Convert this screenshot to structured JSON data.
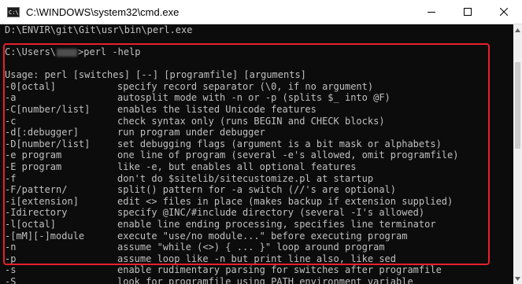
{
  "window": {
    "title": "C:\\WINDOWS\\system32\\cmd.exe",
    "icon_text": "C:\\"
  },
  "console": {
    "previous_line": "D:\\ENVIR\\git\\Git\\usr\\bin\\perl.exe",
    "prompt_prefix": "C:\\Users\\",
    "prompt_suffix": ">perl -help",
    "usage_line": "Usage: perl [switches] [--] [programfile] [arguments]",
    "options": [
      {
        "flag": "-0[octal]",
        "desc": "specify record separator (\\0, if no argument)"
      },
      {
        "flag": "-a",
        "desc": "autosplit mode with -n or -p (splits $_ into @F)"
      },
      {
        "flag": "-C[number/list]",
        "desc": "enables the listed Unicode features"
      },
      {
        "flag": "-c",
        "desc": "check syntax only (runs BEGIN and CHECK blocks)"
      },
      {
        "flag": "-d[:debugger]",
        "desc": "run program under debugger"
      },
      {
        "flag": "-D[number/list]",
        "desc": "set debugging flags (argument is a bit mask or alphabets)"
      },
      {
        "flag": "-e program",
        "desc": "one line of program (several -e's allowed, omit programfile)"
      },
      {
        "flag": "-E program",
        "desc": "like -e, but enables all optional features"
      },
      {
        "flag": "-f",
        "desc": "don't do $sitelib/sitecustomize.pl at startup"
      },
      {
        "flag": "-F/pattern/",
        "desc": "split() pattern for -a switch (//'s are optional)"
      },
      {
        "flag": "-i[extension]",
        "desc": "edit <> files in place (makes backup if extension supplied)"
      },
      {
        "flag": "-Idirectory",
        "desc": "specify @INC/#include directory (several -I's allowed)"
      },
      {
        "flag": "-l[octal]",
        "desc": "enable line ending processing, specifies line terminator"
      },
      {
        "flag": "-[mM][-]module",
        "desc": "execute \"use/no module...\" before executing program"
      },
      {
        "flag": "-n",
        "desc": "assume \"while (<>) { ... }\" loop around program"
      },
      {
        "flag": "-p",
        "desc": "assume loop like -n but print line also, like sed"
      },
      {
        "flag": "-s",
        "desc": "enable rudimentary parsing for switches after programfile"
      },
      {
        "flag": "-S",
        "desc": "look for programfile using PATH environment variable"
      }
    ]
  },
  "colors": {
    "console_bg": "#0c0c0c",
    "console_text": "#c0c0c0",
    "highlight": "#e8202a"
  },
  "icons": [
    "cmd-app-icon",
    "minimize-icon",
    "maximize-icon",
    "close-icon",
    "scroll-up-icon",
    "scroll-down-icon"
  ]
}
